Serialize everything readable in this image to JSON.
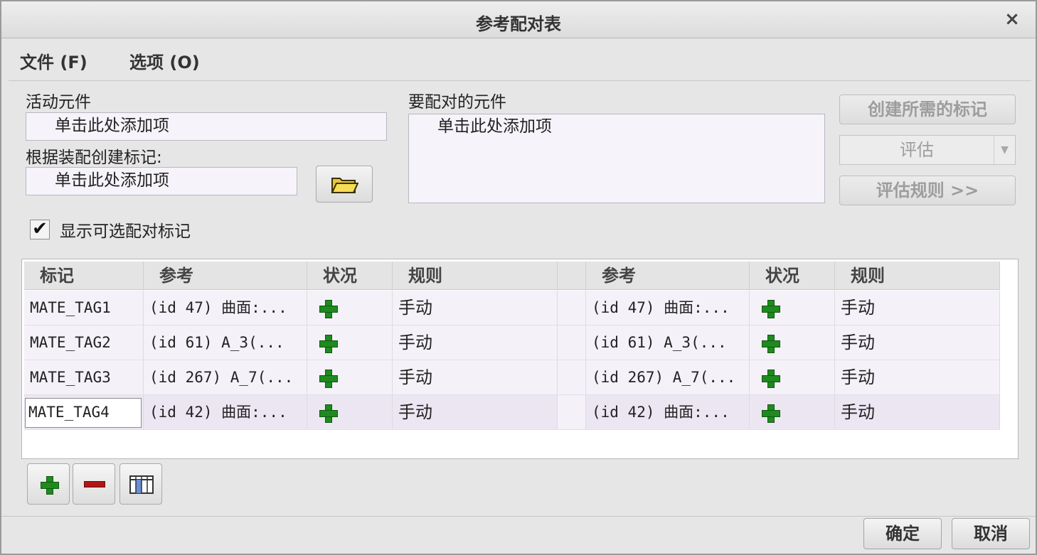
{
  "window": {
    "title": "参考配对表",
    "close_glyph": "×"
  },
  "menu": {
    "items": [
      {
        "label": "文件 (F)"
      },
      {
        "label": "选项 (O)"
      }
    ]
  },
  "form": {
    "active_component_label": "活动元件",
    "active_component_placeholder": "单击此处添加项",
    "create_from_assembly_label": "根据装配创建标记:",
    "create_from_assembly_placeholder": "单击此处添加项",
    "components_to_mate_label": "要配对的元件",
    "components_to_mate_placeholder": "单击此处添加项",
    "show_optional_label": "显示可选配对标记",
    "show_optional_checked": true
  },
  "side_buttons": {
    "create_required_tags": "创建所需的标记",
    "evaluate": "评估",
    "evaluate_rules": "评估规则 >>"
  },
  "table": {
    "headers": [
      "标记",
      "参考",
      "状况",
      "规则",
      "参考",
      "状况",
      "规则"
    ],
    "rows": [
      {
        "tag": "MATE_TAG1",
        "ref1": "(id 47) 曲面:...",
        "status1": "plus-icon",
        "rule1": "手动",
        "ref2": "(id 47) 曲面:...",
        "status2": "plus-icon",
        "rule2": "手动"
      },
      {
        "tag": "MATE_TAG2",
        "ref1": "(id 61) A_3(...",
        "status1": "plus-icon",
        "rule1": "手动",
        "ref2": "(id 61) A_3(...",
        "status2": "plus-icon",
        "rule2": "手动"
      },
      {
        "tag": "MATE_TAG3",
        "ref1": "(id 267) A_7(...",
        "status1": "plus-icon",
        "rule1": "手动",
        "ref2": "(id 267) A_7(...",
        "status2": "plus-icon",
        "rule2": "手动"
      },
      {
        "tag": "MATE_TAG4",
        "ref1": "(id 42) 曲面:...",
        "status1": "plus-icon",
        "rule1": "手动",
        "ref2": "(id 42) 曲面:...",
        "status2": "plus-icon",
        "rule2": "手动"
      }
    ],
    "status_color": "#1f8a1f"
  },
  "toolbar": {
    "add_icon": "plus-icon",
    "remove_icon": "minus-icon",
    "columns_icon": "columns-icon"
  },
  "footer": {
    "ok_label": "确定",
    "cancel_label": "取消"
  }
}
